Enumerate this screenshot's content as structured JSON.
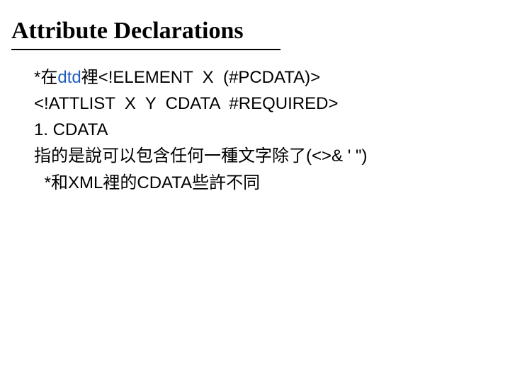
{
  "title": "Attribute Declarations",
  "lines": {
    "l1_prefix": "*在",
    "l1_dtd": "dtd",
    "l1_suffix": "裡<!ELEMENT  X  (#PCDATA)>",
    "l2": "<!ATTLIST  X  Y  CDATA  #REQUIRED>",
    "l3": "1. CDATA",
    "l4": "指的是說可以包含任何一種文字除了(<>& ' \")",
    "l5": " *和XML裡的CDATA些許不同"
  }
}
